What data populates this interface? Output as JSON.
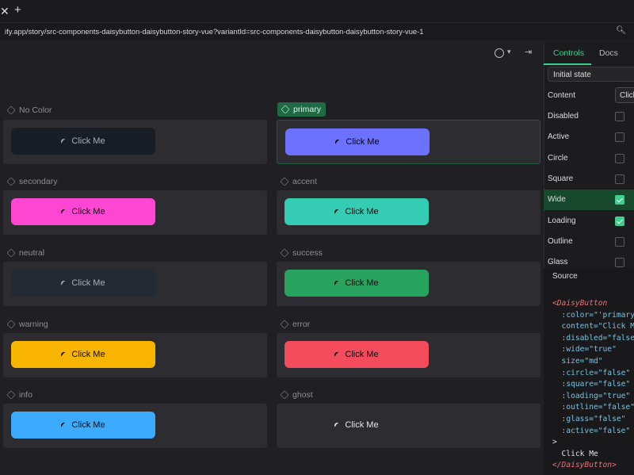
{
  "browser": {
    "close_glyph": "✕",
    "new_tab_glyph": "+",
    "url": "ify.app/story/src-components-daisybutton-daisybutton-story-vue?variantId=src-components-daisybutton-daisybutton-story-vue-1",
    "zoom_icon": "zoom-icon"
  },
  "toolbar": {
    "theme_icon": "circle-icon",
    "caret": "▾",
    "open_glyph": "⇥"
  },
  "variants": [
    {
      "label": "No Color",
      "button": "Click Me",
      "bg": "#191e26",
      "fg": "#a6adbb"
    },
    {
      "label": "primary",
      "button": "Click Me",
      "bg": "#6c72ff",
      "fg": "#060607",
      "selected": true
    },
    {
      "label": "secondary",
      "button": "Click Me",
      "bg": "#ff47d3",
      "fg": "#0b0b0b"
    },
    {
      "label": "accent",
      "button": "Click Me",
      "bg": "#34ccb2",
      "fg": "#0b0b0b"
    },
    {
      "label": "neutral",
      "button": "Click Me",
      "bg": "#242a33",
      "fg": "#a6adbb"
    },
    {
      "label": "success",
      "button": "Click Me",
      "bg": "#27a35d",
      "fg": "#0b0b0b"
    },
    {
      "label": "warning",
      "button": "Click Me",
      "bg": "#f7b500",
      "fg": "#0b0b0b"
    },
    {
      "label": "error",
      "button": "Click Me",
      "bg": "#f44c5c",
      "fg": "#0b0b0b"
    },
    {
      "label": "info",
      "button": "Click Me",
      "bg": "#3cabff",
      "fg": "#0b0b0b"
    },
    {
      "label": "ghost",
      "button": "Click Me",
      "bg": "transparent",
      "fg": "#e6e6e6"
    }
  ],
  "sidebar": {
    "tab_controls": "Controls",
    "tab_docs": "Docs",
    "state": "Initial state",
    "content_label": "Content",
    "content_value": "Click Me",
    "controls": [
      {
        "label": "Disabled",
        "checked": false
      },
      {
        "label": "Active",
        "checked": false
      },
      {
        "label": "Circle",
        "checked": false
      },
      {
        "label": "Square",
        "checked": false
      },
      {
        "label": "Wide",
        "checked": true,
        "highlight": true
      },
      {
        "label": "Loading",
        "checked": true
      },
      {
        "label": "Outline",
        "checked": false
      },
      {
        "label": "Glass",
        "checked": false
      }
    ],
    "source_title": "Source",
    "source_lines": [
      {
        "kind": "tag",
        "text": "<DaisyButton"
      },
      {
        "kind": "attr",
        "text": "  :color=\"'primary'\""
      },
      {
        "kind": "attr",
        "text": "  content=\"Click Me\""
      },
      {
        "kind": "attr",
        "text": "  :disabled=\"false\""
      },
      {
        "kind": "attr",
        "text": "  :wide=\"true\""
      },
      {
        "kind": "attr",
        "text": "  size=\"md\""
      },
      {
        "kind": "attr",
        "text": "  :circle=\"false\""
      },
      {
        "kind": "attr",
        "text": "  :square=\"false\""
      },
      {
        "kind": "attr",
        "text": "  :loading=\"true\""
      },
      {
        "kind": "attr",
        "text": "  :outline=\"false\""
      },
      {
        "kind": "attr",
        "text": "  :glass=\"false\""
      },
      {
        "kind": "attr",
        "text": "  :active=\"false\""
      },
      {
        "kind": "plain",
        "text": ">"
      },
      {
        "kind": "plain",
        "text": "  Click Me"
      },
      {
        "kind": "tag",
        "text": "</DaisyButton>"
      }
    ]
  }
}
